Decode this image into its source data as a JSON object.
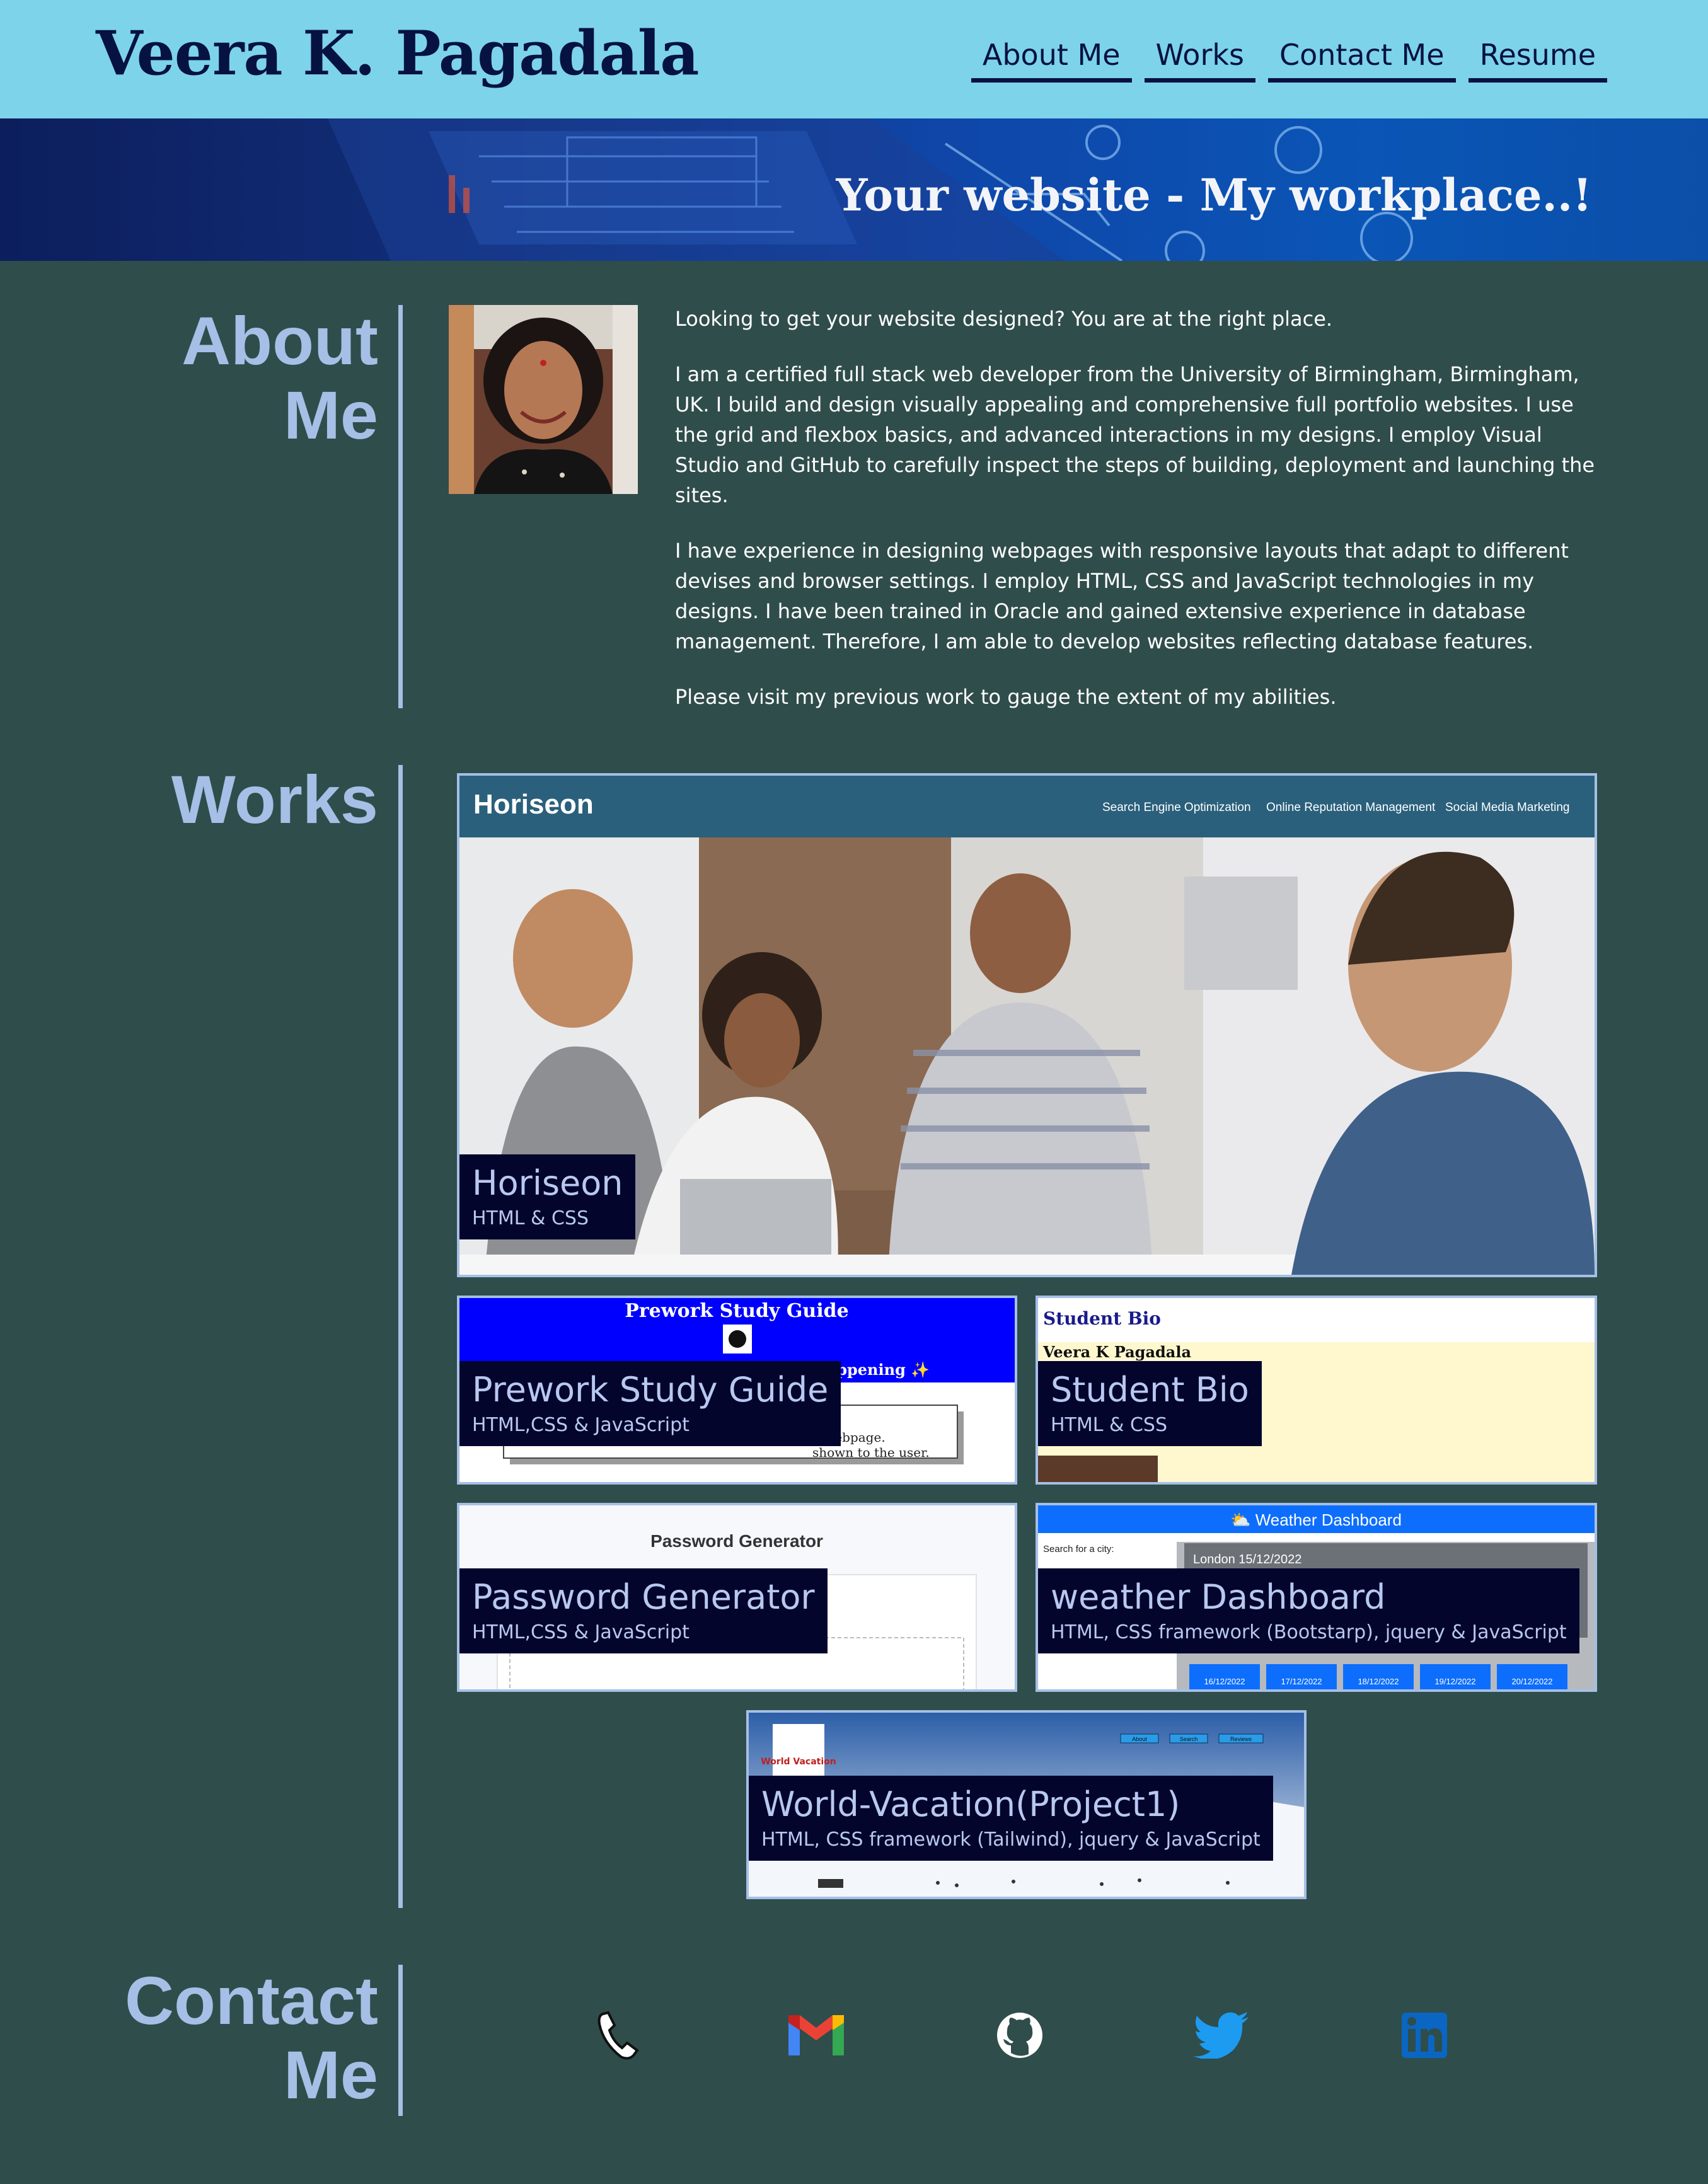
{
  "header": {
    "title": "Veera K. Pagadala",
    "nav": [
      "About Me",
      "Works",
      "Contact Me",
      "Resume"
    ]
  },
  "hero": {
    "tagline": "Your website - My workplace..!"
  },
  "about": {
    "heading": "About Me",
    "paragraphs": [
      "Looking to get your website designed? You are at the right place.",
      "I am a certified full stack web developer from the University of Birmingham, Birmingham, UK. I build and design visually appealing and comprehensive full portfolio websites. I use the grid and flexbox basics, and advanced interactions in my designs. I employ Visual Studio and GitHub to carefully inspect the steps of building, deployment and launching the sites.",
      "I have experience in designing webpages with responsive layouts that adapt to different devises and browser settings. I employ HTML, CSS and JavaScript technologies in my designs. I have been trained in Oracle and gained extensive experience in database management. Therefore, I am able to develop websites reflecting database features.",
      "Please visit my previous work to gauge the extent of my abilities."
    ]
  },
  "works": {
    "heading": "Works",
    "projects": [
      {
        "name": "Horiseon",
        "tech": "HTML & CSS",
        "preview": {
          "brand": "Horiseon",
          "links": [
            "Search Engine Optimization",
            "Online Reputation Management",
            "Social Media Marketing"
          ]
        }
      },
      {
        "name": "Prework Study Guide",
        "tech": "HTML,CSS & JavaScript",
        "preview": {
          "title": "Prework Study Guide",
          "sub": "Happening ✨",
          "line1": "e webpage.",
          "line2": "shown to the user."
        }
      },
      {
        "name": "Student Bio",
        "tech": "HTML & CSS",
        "preview": {
          "title": "Student Bio",
          "owner": "Veera K Pagadala"
        }
      },
      {
        "name": "Password Generator",
        "tech": "HTML,CSS & JavaScript",
        "preview": {
          "title": "Password Generator"
        }
      },
      {
        "name": "weather Dashboard",
        "tech": "HTML, CSS framework (Bootstarp), jquery & JavaScript",
        "preview": {
          "title": "⛅ Weather Dashboard",
          "search": "Search for a city:",
          "city": "London 15/12/2022",
          "days": [
            "16/12/2022",
            "17/12/2022",
            "18/12/2022",
            "19/12/2022",
            "20/12/2022"
          ]
        }
      },
      {
        "name": "World-Vacation(Project1)",
        "tech": "HTML, CSS framework (Tailwind), jquery & JavaScript",
        "preview": {
          "logo": "World Vacation",
          "links": [
            "About",
            "Search",
            "Reviews"
          ]
        }
      }
    ]
  },
  "contact": {
    "heading": "Contact Me",
    "icons": [
      "phone-icon",
      "gmail-icon",
      "github-icon",
      "twitter-icon",
      "linkedin-icon"
    ]
  },
  "colors": {
    "header_bg": "#7dd3ea",
    "page_bg": "#2f4d4b",
    "accent": "#a6bfe6",
    "label_bg": "#03052d",
    "title_text": "#06123f"
  }
}
